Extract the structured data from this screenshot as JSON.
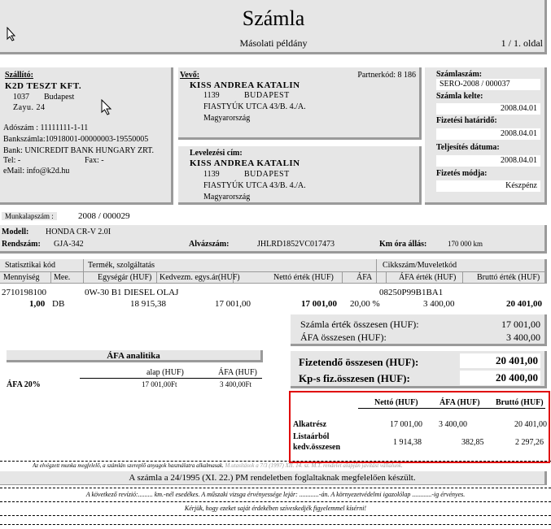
{
  "header": {
    "title": "Számla",
    "subtitle": "Másolati példány",
    "page": "1 / 1. oldal"
  },
  "seller": {
    "heading": "Szállító:",
    "name": "K2D TESZT KFT.",
    "zip": "1037",
    "city": "Budapest",
    "street": "Zayu. 24",
    "tax_id": "Adószám : 11111111-1-11",
    "bank_account": "Bankszámla:10918001-00000003-19550005",
    "bank": "Bank: UNICREDIT BANK HUNGARY ZRT.",
    "tel": "Tel: -",
    "fax": "Fax: -",
    "email": "eMail: info@k2d.hu"
  },
  "buyer": {
    "heading": "Vevő:",
    "partner_code": "Partnerkód: 8 186",
    "name": "KISS ANDREA KATALIN",
    "zip": "1139",
    "city": "BUDAPEST",
    "street": "FIASTYÚK UTCA 43/B. 4./A.",
    "country": "Magyarország"
  },
  "postal": {
    "heading": "Levelezési cím:",
    "name": "KISS ANDREA KATALIN",
    "zip": "1139",
    "city": "BUDAPEST",
    "street": "FIASTYÚK UTCA 43/B. 4./A.",
    "country": "Magyarország"
  },
  "invoice_info": {
    "number_label": "Számlaszám:",
    "number": "SERO-2008 / 000037",
    "date_label": "Számla kelte:",
    "date": "2008.04.01",
    "due_label": "Fizetési határidő:",
    "due": "2008.04.01",
    "perf_label": "Teljesítés dátuma:",
    "perf": "2008.04.01",
    "pay_label": "Fizetés módja:",
    "pay": "Készpénz"
  },
  "worksheet": {
    "label": "Munkalapszám :",
    "value": "2008 / 000029"
  },
  "vehicle": {
    "model_label": "Modell:",
    "model": "HONDA CR-V 2.0I",
    "plate_label": "Rendszám:",
    "plate": "GJA-342",
    "chassis_label": "Alvázszám:",
    "chassis": "JHLRD1852VC017473",
    "km_label": "Km óra állás:",
    "km": "170 000 km"
  },
  "table": {
    "h_stat": "Statisztikai kód",
    "h_product": "Termék, szolgáltatás",
    "h_code": "Cikkszám/Muveletkód",
    "h_qty": "Mennyiség",
    "h_unit": "Mee.",
    "h_unitprice": "Egységár (HUF)",
    "h_discprice": "Kedvezm. egys.ár(HUF)",
    "h_net": "Nettó érték (HUF)",
    "h_vat": "ÁFA",
    "h_vatval": "ÁFA érték (HUF)",
    "h_gross": "Bruttó érték (HUF)",
    "row": {
      "stat": "2710198100",
      "product": "0W-30 B1 DIESEL OLAJ",
      "code": "08250P99B1BA1",
      "qty": "1,00",
      "unit": "DB",
      "unitprice": "18 915,38",
      "discprice": "17 001,00",
      "net": "17 001,00",
      "vat": "20,00 %",
      "vatval": "3 400,00",
      "gross": "20 401,00"
    }
  },
  "totals": {
    "sum_label": "Számla érték összesen (HUF):",
    "sum": "17 001,00",
    "vat_label": "ÁFA összesen (HUF):",
    "vat": "3 400,00",
    "payable_label": "Fizetendő összesen (HUF):",
    "payable": "20 401,00",
    "cash_label": "Kp-s fiz.összesen (HUF):",
    "cash": "20 400,00"
  },
  "vat_analysis": {
    "title": "ÁFA analitika",
    "h_base": "alap (HUF)",
    "h_vat": "ÁFA (HUF)",
    "rate": "ÁFA 20%",
    "base": "17 001,00Ft",
    "vat": "3 400,00Ft"
  },
  "breakdown": {
    "h_net": "Nettó (HUF)",
    "h_vat": "ÁFA (HUF)",
    "h_gross": "Bruttó (HUF)",
    "r1_label": "Alkatrész",
    "r1_net": "17 001,00",
    "r1_vat": "3 400,00",
    "r1_gross": "20 401,00",
    "r2_label1": "Listaárból",
    "r2_label2": "kedv.összesen",
    "r2_net": "1 914,38",
    "r2_vat": "382,85",
    "r2_gross": "2 297,26",
    "highlight_color": "#e00000"
  },
  "footer": {
    "note1": "Az elvégzett munka megfelelő, a számlán szereplő anyagok használatra alkalmasak.",
    "note1_tail": "M.utasítások a 7/3 (1997) XII. 14. sz. M.T. rendelet alapján javítást vállalunk.",
    "legal": "A számla a 24/1995 (XI. 22.) PM rendeletben foglaltaknak megfelelően készült.",
    "next_service": "A következő revízió:......... km.-nél esedékes. A műszaki vizsga érvényessége lejár: ............-án. A környezetvédelmi igazolólap ............-ig érvényes.",
    "request": "Kérjük, hogy ezeket saját érdekében szíveskedjék figyelemmel kísérni!"
  }
}
